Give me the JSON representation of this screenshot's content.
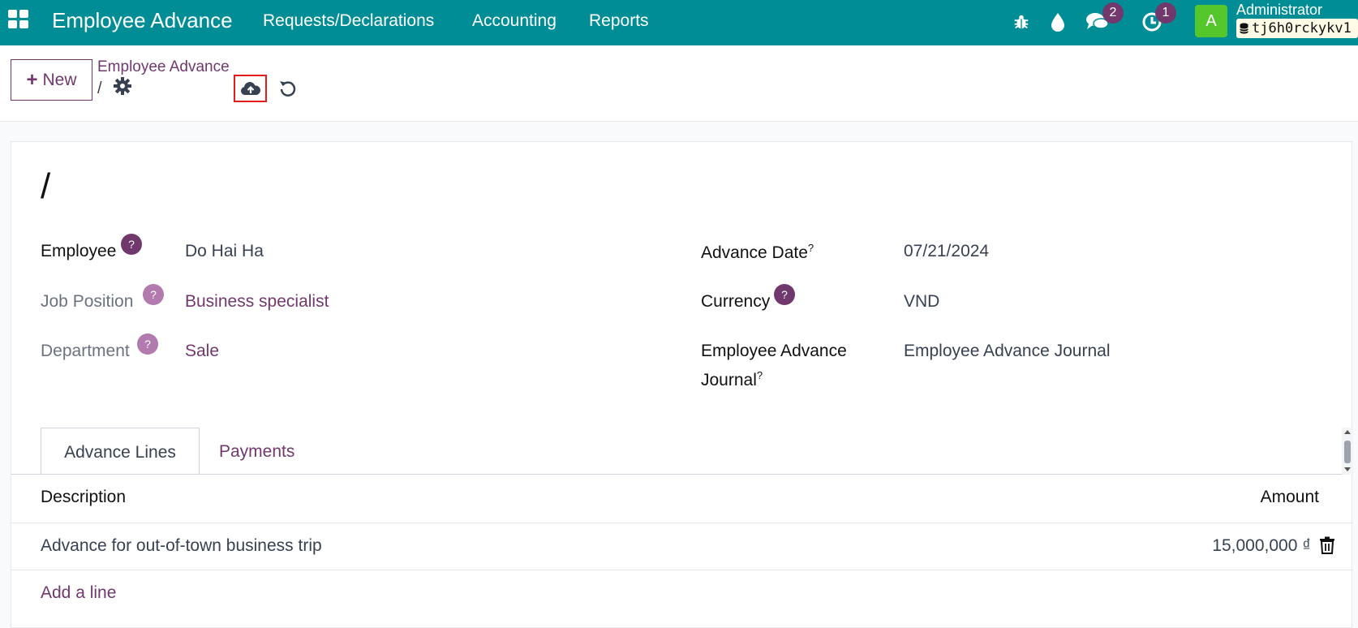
{
  "navbar": {
    "app_name": "Employee Advance",
    "menus": [
      "Requests/Declarations",
      "Accounting",
      "Reports"
    ],
    "messages_count": "2",
    "activities_count": "1",
    "avatar_letter": "A",
    "user_name": "Administrator",
    "db_name": "tj6h0rckykv1"
  },
  "control_panel": {
    "new_label": "New",
    "breadcrumb_parent": "Employee Advance",
    "breadcrumb_current": "/"
  },
  "form": {
    "record_name": "/",
    "fields": {
      "employee": {
        "label": "Employee",
        "value": "Do Hai Ha"
      },
      "job_position": {
        "label": "Job Position",
        "value": "Business specialist"
      },
      "department": {
        "label": "Department",
        "value": "Sale"
      },
      "advance_date": {
        "label": "Advance Date",
        "value": "07/21/2024"
      },
      "currency": {
        "label": "Currency",
        "value": "VND"
      },
      "journal": {
        "label_line1": "Employee Advance",
        "label_line2": "Journal",
        "value": "Employee Advance Journal"
      }
    },
    "help_mark": "?",
    "tabs": [
      "Advance Lines",
      "Payments"
    ],
    "table": {
      "columns": [
        "Description",
        "Amount"
      ],
      "rows": [
        {
          "description": "Advance for out-of-town business trip",
          "amount": "15,000,000 ₫"
        }
      ],
      "add_line": "Add a line"
    }
  },
  "colors": {
    "navbar": "#018d96",
    "primary": "#71386e",
    "highlight": "#e11d1d",
    "avatar": "#55c72c"
  }
}
